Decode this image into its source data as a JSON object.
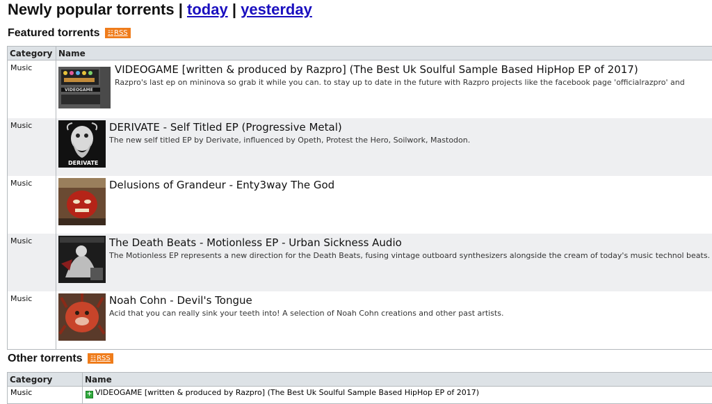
{
  "header": {
    "title": "Newly popular torrents |",
    "sep": "|",
    "link_today": "today",
    "link_yesterday": "yesterday"
  },
  "featured": {
    "heading": "Featured torrents",
    "rss_label": "RSS",
    "columns": [
      "Category",
      "Name"
    ],
    "rows": [
      {
        "category": "Music",
        "title": "VIDEOGAME [written & produced by Razpro] (The Best Uk Soulful Sample Based HipHop EP of 2017)",
        "description": "Razpro's last ep on mininova so grab it while you can. to stay up to date in the future with Razpro projects like the facebook page 'officialrazpro' and",
        "thumb_caption": "VIDEOGAME",
        "thumb": "handheld-console-cover"
      },
      {
        "category": "Music",
        "title": "DERIVATE - Self Titled EP (Progressive Metal)",
        "description": "The new self titled EP by Derivate, influenced by Opeth, Protest the Hero, Soilwork, Mastodon.",
        "thumb_caption": "DERIVATE",
        "thumb": "bearded-face-cover"
      },
      {
        "category": "Music",
        "title": "Delusions of Grandeur - Enty3way The God",
        "description": "",
        "thumb": "red-mask-cover"
      },
      {
        "category": "Music",
        "title": "The Death Beats - Motionless EP - Urban Sickness Audio",
        "description": "The Motionless EP represents a new direction for the Death Beats, fusing vintage outboard synthesizers alongside the cream of today's music technol beats.",
        "thumb": "figure-collage-cover"
      },
      {
        "category": "Music",
        "title": "Noah Cohn - Devil's Tongue",
        "description": "Acid that you can really sink your teeth into! A selection of Noah Cohn creations and other past artists.",
        "thumb": "red-creature-cover"
      }
    ]
  },
  "other": {
    "heading": "Other torrents",
    "rss_label": "RSS",
    "columns": [
      "Category",
      "Name"
    ],
    "rows": [
      {
        "category": "Music",
        "name": "VIDEOGAME [written & produced by Razpro] (The Best Uk Soulful Sample Based HipHop EP of 2017)"
      }
    ]
  },
  "colors": {
    "link": "#1a0fbf",
    "rss_badge": "#ef7c1b",
    "header_bg": "#dde2e6",
    "alt_row_bg": "#eeeff1",
    "new_icon": "#2fa83c"
  }
}
